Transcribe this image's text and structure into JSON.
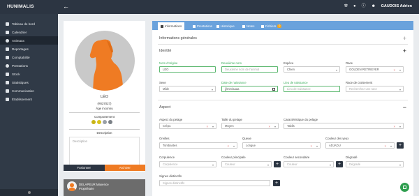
{
  "app": {
    "title": "HUNIMALIS",
    "back_icon": "arrow-left-icon",
    "user": "GAUDOIS Adrien"
  },
  "top_icons": [
    "wrench-icon",
    "bell-icon",
    "info-icon",
    "user-icon"
  ],
  "sidebar": {
    "items": [
      {
        "label": "Tableau de bord",
        "icon": "dashboard-icon"
      },
      {
        "label": "Calendrier",
        "icon": "calendar-icon"
      },
      {
        "label": "Animaux",
        "icon": "paw-icon"
      },
      {
        "label": "Reportages",
        "icon": "report-icon"
      },
      {
        "label": "Comptabilité",
        "icon": "ledger-icon"
      },
      {
        "label": "Prestations",
        "icon": "service-icon"
      },
      {
        "label": "Stock",
        "icon": "box-icon"
      },
      {
        "label": "Statistiques",
        "icon": "stats-icon"
      },
      {
        "label": "Communication",
        "icon": "message-icon"
      },
      {
        "label": "Établissement",
        "icon": "building-icon"
      }
    ],
    "active_index": 2
  },
  "profile": {
    "name": "LÉO",
    "id": "(#837027)",
    "age": "Âge inconnu",
    "comportement_label": "Comportement",
    "comportement_colors": [
      "#c8b416",
      "#d8c21a",
      "#9aa0a6",
      "#7b8187"
    ],
    "description_label": "Description",
    "description_placeholder": "Description",
    "buttons": {
      "merge": "Fusionner",
      "archive": "Archiver"
    },
    "owner": {
      "name": "DELAPEUR Maxence",
      "role": "Propriétaire"
    }
  },
  "tabs": [
    {
      "label": "Informations",
      "icon": "file-icon"
    },
    {
      "label": "Prestations",
      "icon": "service-icon"
    },
    {
      "label": "Historique",
      "icon": "history-icon"
    },
    {
      "label": "Notes",
      "icon": "note-icon"
    },
    {
      "label": "Fichiers",
      "icon": "folder-icon",
      "badge": "0"
    }
  ],
  "sections": {
    "general": {
      "title": "Informations générales",
      "toggle": "+"
    },
    "identity": {
      "title": "Identité",
      "toggle": "+",
      "fields": {
        "nom": {
          "label": "Nom d'origine",
          "value": "LÉO"
        },
        "deuxieme_nom": {
          "label": "Deuxième nom",
          "placeholder": "Deuxième nom de l'animal"
        },
        "espece": {
          "label": "Espèce",
          "value": "Chien"
        },
        "race": {
          "label": "Race",
          "value": "GOLDEN RETRIEVER"
        },
        "sexe": {
          "label": "Sexe",
          "value": "Mâle"
        },
        "date_naissance": {
          "label": "Date de naissance",
          "value": "jj/mm/aaaa"
        },
        "lieu_naissance": {
          "label": "Lieu de naissance",
          "placeholder": "Lieu de naissance"
        },
        "race_croisement": {
          "label": "Race de croisement",
          "placeholder": "Recherchez une race"
        }
      }
    },
    "aspect": {
      "title": "Aspect",
      "toggle": "−",
      "fields": {
        "aspect_pelage": {
          "label": "Aspect du pelage",
          "value": "Crépu"
        },
        "taille_pelage": {
          "label": "Taille du pelage",
          "value": "Moyen"
        },
        "carac_pelage": {
          "label": "Caractéristique du pelage",
          "value": "Tablis"
        },
        "oreilles": {
          "label": "Oreilles",
          "value": "Tombantes"
        },
        "queue": {
          "label": "Queue",
          "value": "Longue"
        },
        "yeux": {
          "label": "Couleur des yeux",
          "value": "ADJADU"
        },
        "corpulence": {
          "label": "Corpulence",
          "placeholder": "Corpulence"
        },
        "couleur_principale": {
          "label": "Couleur principale",
          "placeholder": "Couleur"
        },
        "couleur_secondaire": {
          "label": "Couleur secondaire",
          "placeholder": "Couleur"
        },
        "degrade": {
          "label": "Dégradé",
          "placeholder": "Dégradé"
        },
        "signes": {
          "label": "Signes distinctifs",
          "placeholder": "Signes distinctifs"
        }
      },
      "add_label": "+"
    }
  },
  "fab_icon": "save-icon"
}
